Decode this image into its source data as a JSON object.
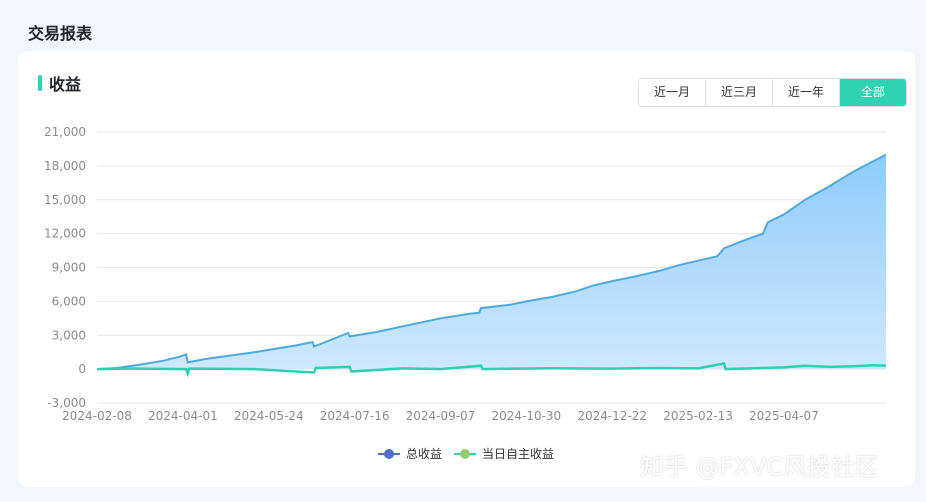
{
  "page": {
    "title": "交易报表"
  },
  "card": {
    "title": "收益"
  },
  "range_buttons": [
    {
      "label": "近一月",
      "active": false
    },
    {
      "label": "近三月",
      "active": false
    },
    {
      "label": "近一年",
      "active": false
    },
    {
      "label": "全部",
      "active": true
    }
  ],
  "watermark": "知乎 @FXVC风投社区",
  "colors": {
    "accent": "#2fd3b3",
    "total_line": "#4fa9de",
    "total_fill_top": "#8ecbfb",
    "total_fill_bottom": "#cfe8fd",
    "daily_line": "#2fcfb2",
    "legend_total_dot": "#5470c6",
    "legend_daily_dot": "#91cc75"
  },
  "chart_data": {
    "type": "area",
    "ylim": [
      -3000,
      21000
    ],
    "y_ticks": [
      -3000,
      0,
      3000,
      6000,
      9000,
      12000,
      15000,
      18000,
      21000
    ],
    "y_tick_labels": [
      "-3,000",
      "0",
      "3,000",
      "6,000",
      "9,000",
      "12,000",
      "15,000",
      "18,000",
      "21,000"
    ],
    "x_range": [
      "2024-02-08",
      "2025-06-09"
    ],
    "x_tick_labels": [
      "2024-02-08",
      "2024-04-01",
      "2024-05-24",
      "2024-07-16",
      "2024-09-07",
      "2024-10-30",
      "2024-12-22",
      "2025-02-13",
      "2025-04-07"
    ],
    "legend": [
      "总收益",
      "当日自主收益"
    ],
    "series": [
      {
        "name": "总收益",
        "type": "area",
        "points": [
          [
            "2024-02-08",
            0
          ],
          [
            "2024-02-20",
            100
          ],
          [
            "2024-03-01",
            300
          ],
          [
            "2024-03-10",
            500
          ],
          [
            "2024-03-20",
            750
          ],
          [
            "2024-03-30",
            1100
          ],
          [
            "2024-04-03",
            1300
          ],
          [
            "2024-04-04",
            600
          ],
          [
            "2024-04-15",
            900
          ],
          [
            "2024-04-30",
            1200
          ],
          [
            "2024-05-15",
            1500
          ],
          [
            "2024-05-24",
            1700
          ],
          [
            "2024-06-10",
            2100
          ],
          [
            "2024-06-20",
            2400
          ],
          [
            "2024-06-21",
            2000
          ],
          [
            "2024-07-05",
            2800
          ],
          [
            "2024-07-12",
            3200
          ],
          [
            "2024-07-13",
            2900
          ],
          [
            "2024-07-30",
            3300
          ],
          [
            "2024-08-15",
            3800
          ],
          [
            "2024-08-25",
            4100
          ],
          [
            "2024-09-07",
            4500
          ],
          [
            "2024-09-25",
            4900
          ],
          [
            "2024-10-01",
            5000
          ],
          [
            "2024-10-02",
            5400
          ],
          [
            "2024-10-20",
            5700
          ],
          [
            "2024-10-30",
            6000
          ],
          [
            "2024-11-15",
            6400
          ],
          [
            "2024-11-30",
            6900
          ],
          [
            "2024-12-10",
            7400
          ],
          [
            "2024-12-22",
            7800
          ],
          [
            "2025-01-05",
            8200
          ],
          [
            "2025-01-20",
            8700
          ],
          [
            "2025-02-01",
            9200
          ],
          [
            "2025-02-13",
            9600
          ],
          [
            "2025-02-25",
            10000
          ],
          [
            "2025-03-01",
            10700
          ],
          [
            "2025-03-15",
            11500
          ],
          [
            "2025-03-25",
            12000
          ],
          [
            "2025-03-28",
            13000
          ],
          [
            "2025-04-07",
            13700
          ],
          [
            "2025-04-20",
            15000
          ],
          [
            "2025-05-05",
            16200
          ],
          [
            "2025-05-20",
            17500
          ],
          [
            "2025-06-01",
            18400
          ],
          [
            "2025-06-09",
            19000
          ]
        ]
      },
      {
        "name": "当日自主收益",
        "type": "line",
        "points": [
          [
            "2024-02-08",
            0
          ],
          [
            "2024-03-01",
            50
          ],
          [
            "2024-04-03",
            0
          ],
          [
            "2024-04-04",
            -400
          ],
          [
            "2024-04-05",
            50
          ],
          [
            "2024-05-15",
            0
          ],
          [
            "2024-06-21",
            -300
          ],
          [
            "2024-06-22",
            100
          ],
          [
            "2024-07-13",
            200
          ],
          [
            "2024-07-14",
            -200
          ],
          [
            "2024-08-15",
            60
          ],
          [
            "2024-09-07",
            0
          ],
          [
            "2024-10-02",
            300
          ],
          [
            "2024-10-03",
            0
          ],
          [
            "2024-11-15",
            80
          ],
          [
            "2024-12-22",
            50
          ],
          [
            "2025-01-20",
            100
          ],
          [
            "2025-02-13",
            60
          ],
          [
            "2025-03-01",
            500
          ],
          [
            "2025-03-02",
            0
          ],
          [
            "2025-04-07",
            150
          ],
          [
            "2025-04-20",
            300
          ],
          [
            "2025-05-05",
            200
          ],
          [
            "2025-05-20",
            250
          ],
          [
            "2025-06-01",
            350
          ],
          [
            "2025-06-09",
            300
          ]
        ]
      }
    ]
  }
}
